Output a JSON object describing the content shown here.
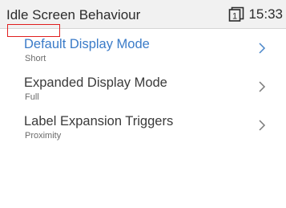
{
  "header": {
    "title": "Idle Screen Behaviour",
    "line_icon": "line-number-icon",
    "line_number": "1",
    "time": "15:33"
  },
  "menu": {
    "items": [
      {
        "label": "Default Display Mode",
        "value": "Short",
        "selected": true
      },
      {
        "label": "Expanded Display Mode",
        "value": "Full",
        "selected": false
      },
      {
        "label": "Label Expansion Triggers",
        "value": "Proximity",
        "selected": false
      }
    ]
  },
  "colors": {
    "selected_text": "#3a7bc8",
    "highlight_box": "#e01e1e",
    "header_bg": "#f1f1f1"
  }
}
